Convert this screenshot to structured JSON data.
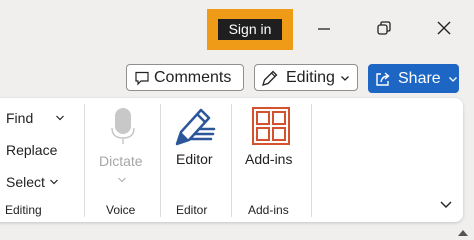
{
  "titlebar": {
    "sign_in_label": "Sign in"
  },
  "toolbar": {
    "comments_label": "Comments",
    "editing_label": "Editing",
    "share_label": "Share"
  },
  "ribbon": {
    "editing_group": {
      "find_label": "Find",
      "replace_label": "Replace",
      "select_label": "Select",
      "group_label": "Editing"
    },
    "voice_group": {
      "dictate_label": "Dictate",
      "group_label": "Voice"
    },
    "editor_group": {
      "editor_label": "Editor",
      "group_label": "Editor"
    },
    "addins_group": {
      "addins_label": "Add-ins",
      "group_label": "Add-ins"
    }
  },
  "colors": {
    "sign_in_highlight": "#f09b17",
    "share_button": "#1d66c4",
    "addins_icon": "#d35230",
    "editor_icon": "#2b579a",
    "disabled_text": "#a6a6a6"
  },
  "icons": [
    "minimize-icon",
    "restore-icon",
    "close-icon",
    "comment-icon",
    "pencil-icon",
    "share-icon",
    "microphone-icon",
    "editor-pen-icon",
    "addins-grid-icon",
    "chevron-down-icon",
    "collapse-ribbon-icon"
  ]
}
